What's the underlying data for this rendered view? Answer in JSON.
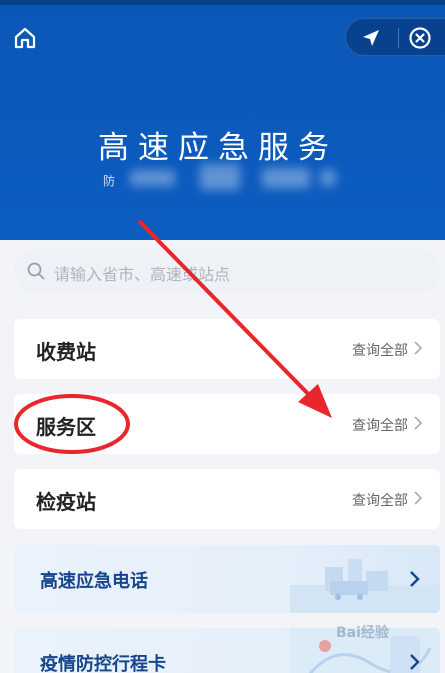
{
  "header": {
    "title": "高速应急服务",
    "subtitle": "防"
  },
  "search": {
    "placeholder": "请输入省市、高速或站点"
  },
  "cards": [
    {
      "label": "收费站",
      "more": "查询全部"
    },
    {
      "label": "服务区",
      "more": "查询全部"
    },
    {
      "label": "检疫站",
      "more": "查询全部"
    }
  ],
  "banners": [
    {
      "label": "高速应急电话"
    },
    {
      "label": "疫情防控行程卡"
    }
  ],
  "watermark": "Bai经验",
  "colors": {
    "header": "#0b57b7",
    "annotation": "#e8262b",
    "banner_text": "#17458c"
  }
}
